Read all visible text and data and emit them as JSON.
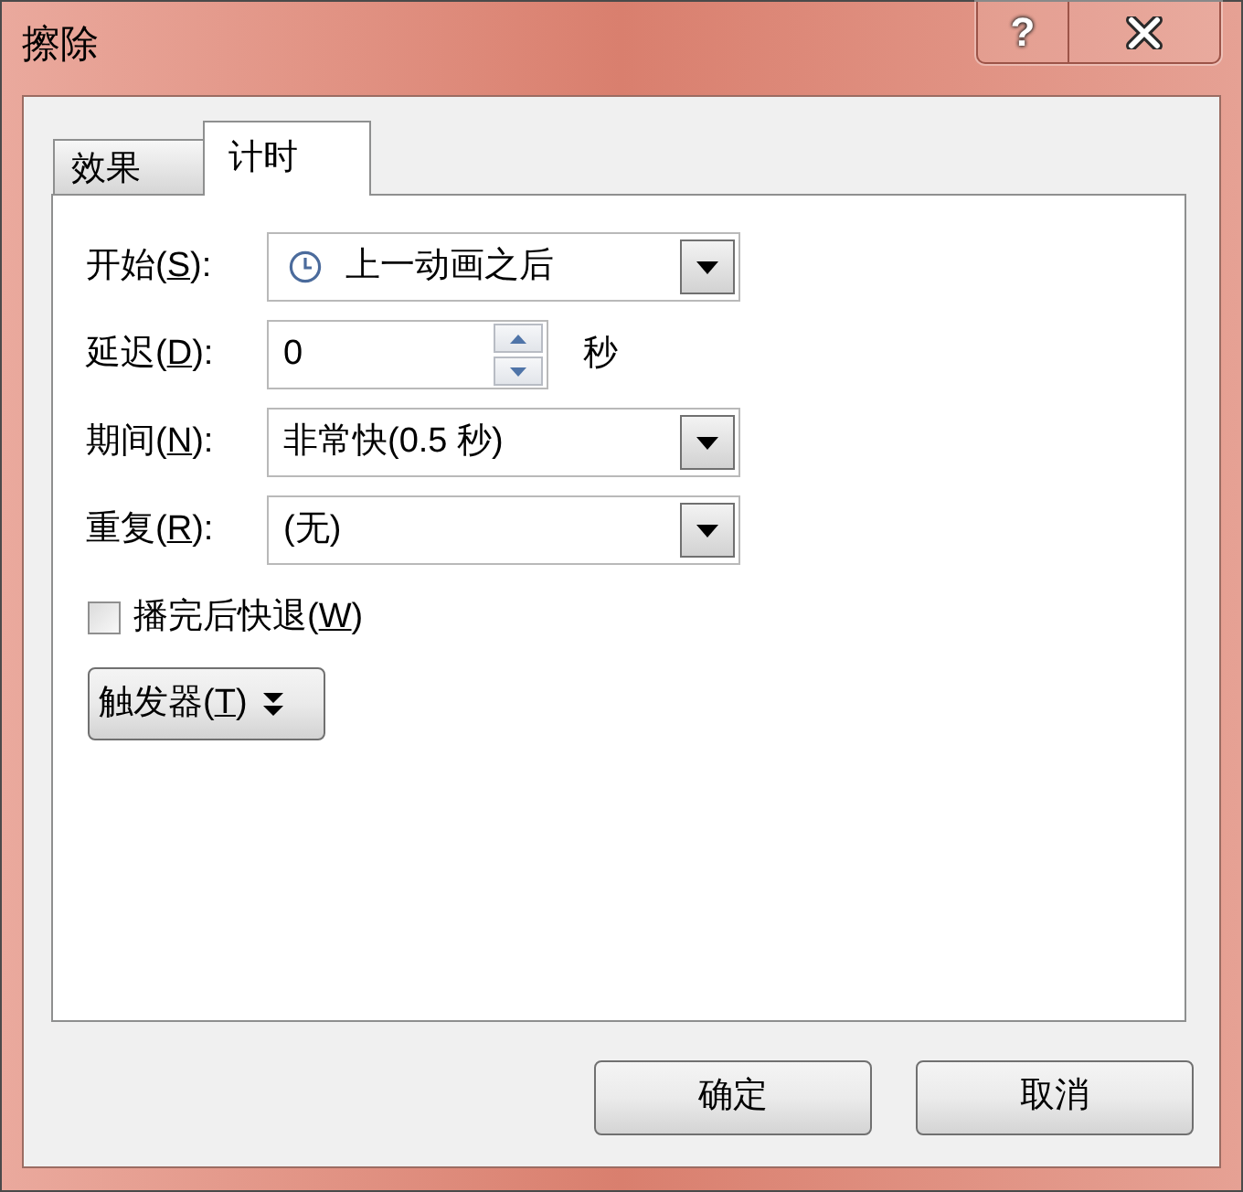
{
  "window": {
    "title": "擦除",
    "help_button": "?"
  },
  "tabs": [
    {
      "label": "效果",
      "selected": false
    },
    {
      "label": "计时",
      "selected": true
    }
  ],
  "fields": [
    {
      "kind": "iconselect",
      "label": {
        "prefix": "开始(",
        "access_key": "S",
        "suffix": "):"
      },
      "value": "上一动画之后"
    },
    {
      "kind": "spinner",
      "label": {
        "prefix": "延迟(",
        "access_key": "D",
        "suffix": "):"
      },
      "value": "0",
      "unit": "秒"
    },
    {
      "kind": "select",
      "label": {
        "prefix": "期间(",
        "access_key": "N",
        "suffix": "):"
      },
      "value": "非常快(0.5 秒)"
    },
    {
      "kind": "select",
      "label": {
        "prefix": "重复(",
        "access_key": "R",
        "suffix": "):"
      },
      "value": "(无)"
    }
  ],
  "checkbox": {
    "label": {
      "prefix": "播完后快退(",
      "access_key": "W",
      "suffix": ")"
    },
    "checked": false
  },
  "trigger_button": {
    "prefix": "触发器(",
    "access_key": "T",
    "suffix": ")"
  },
  "buttons": [
    "确定",
    "取消"
  ]
}
